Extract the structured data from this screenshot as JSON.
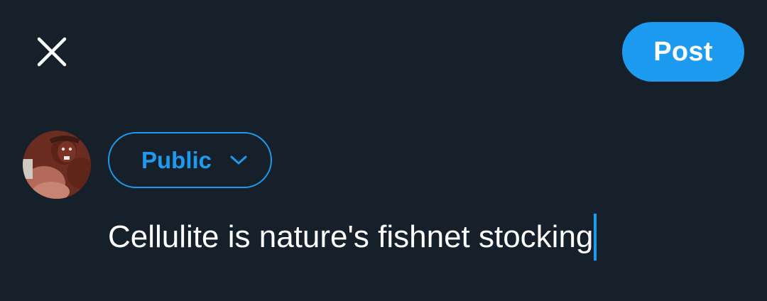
{
  "header": {
    "close_icon": "close-icon",
    "post_label": "Post"
  },
  "composer": {
    "avatar_icon": "user-avatar",
    "audience_label": "Public",
    "audience_icon": "chevron-down-icon",
    "text": "Cellulite is nature's fishnet stocking"
  },
  "colors": {
    "background": "#15202b",
    "accent": "#1d9bf0",
    "text": "#ffffff"
  }
}
